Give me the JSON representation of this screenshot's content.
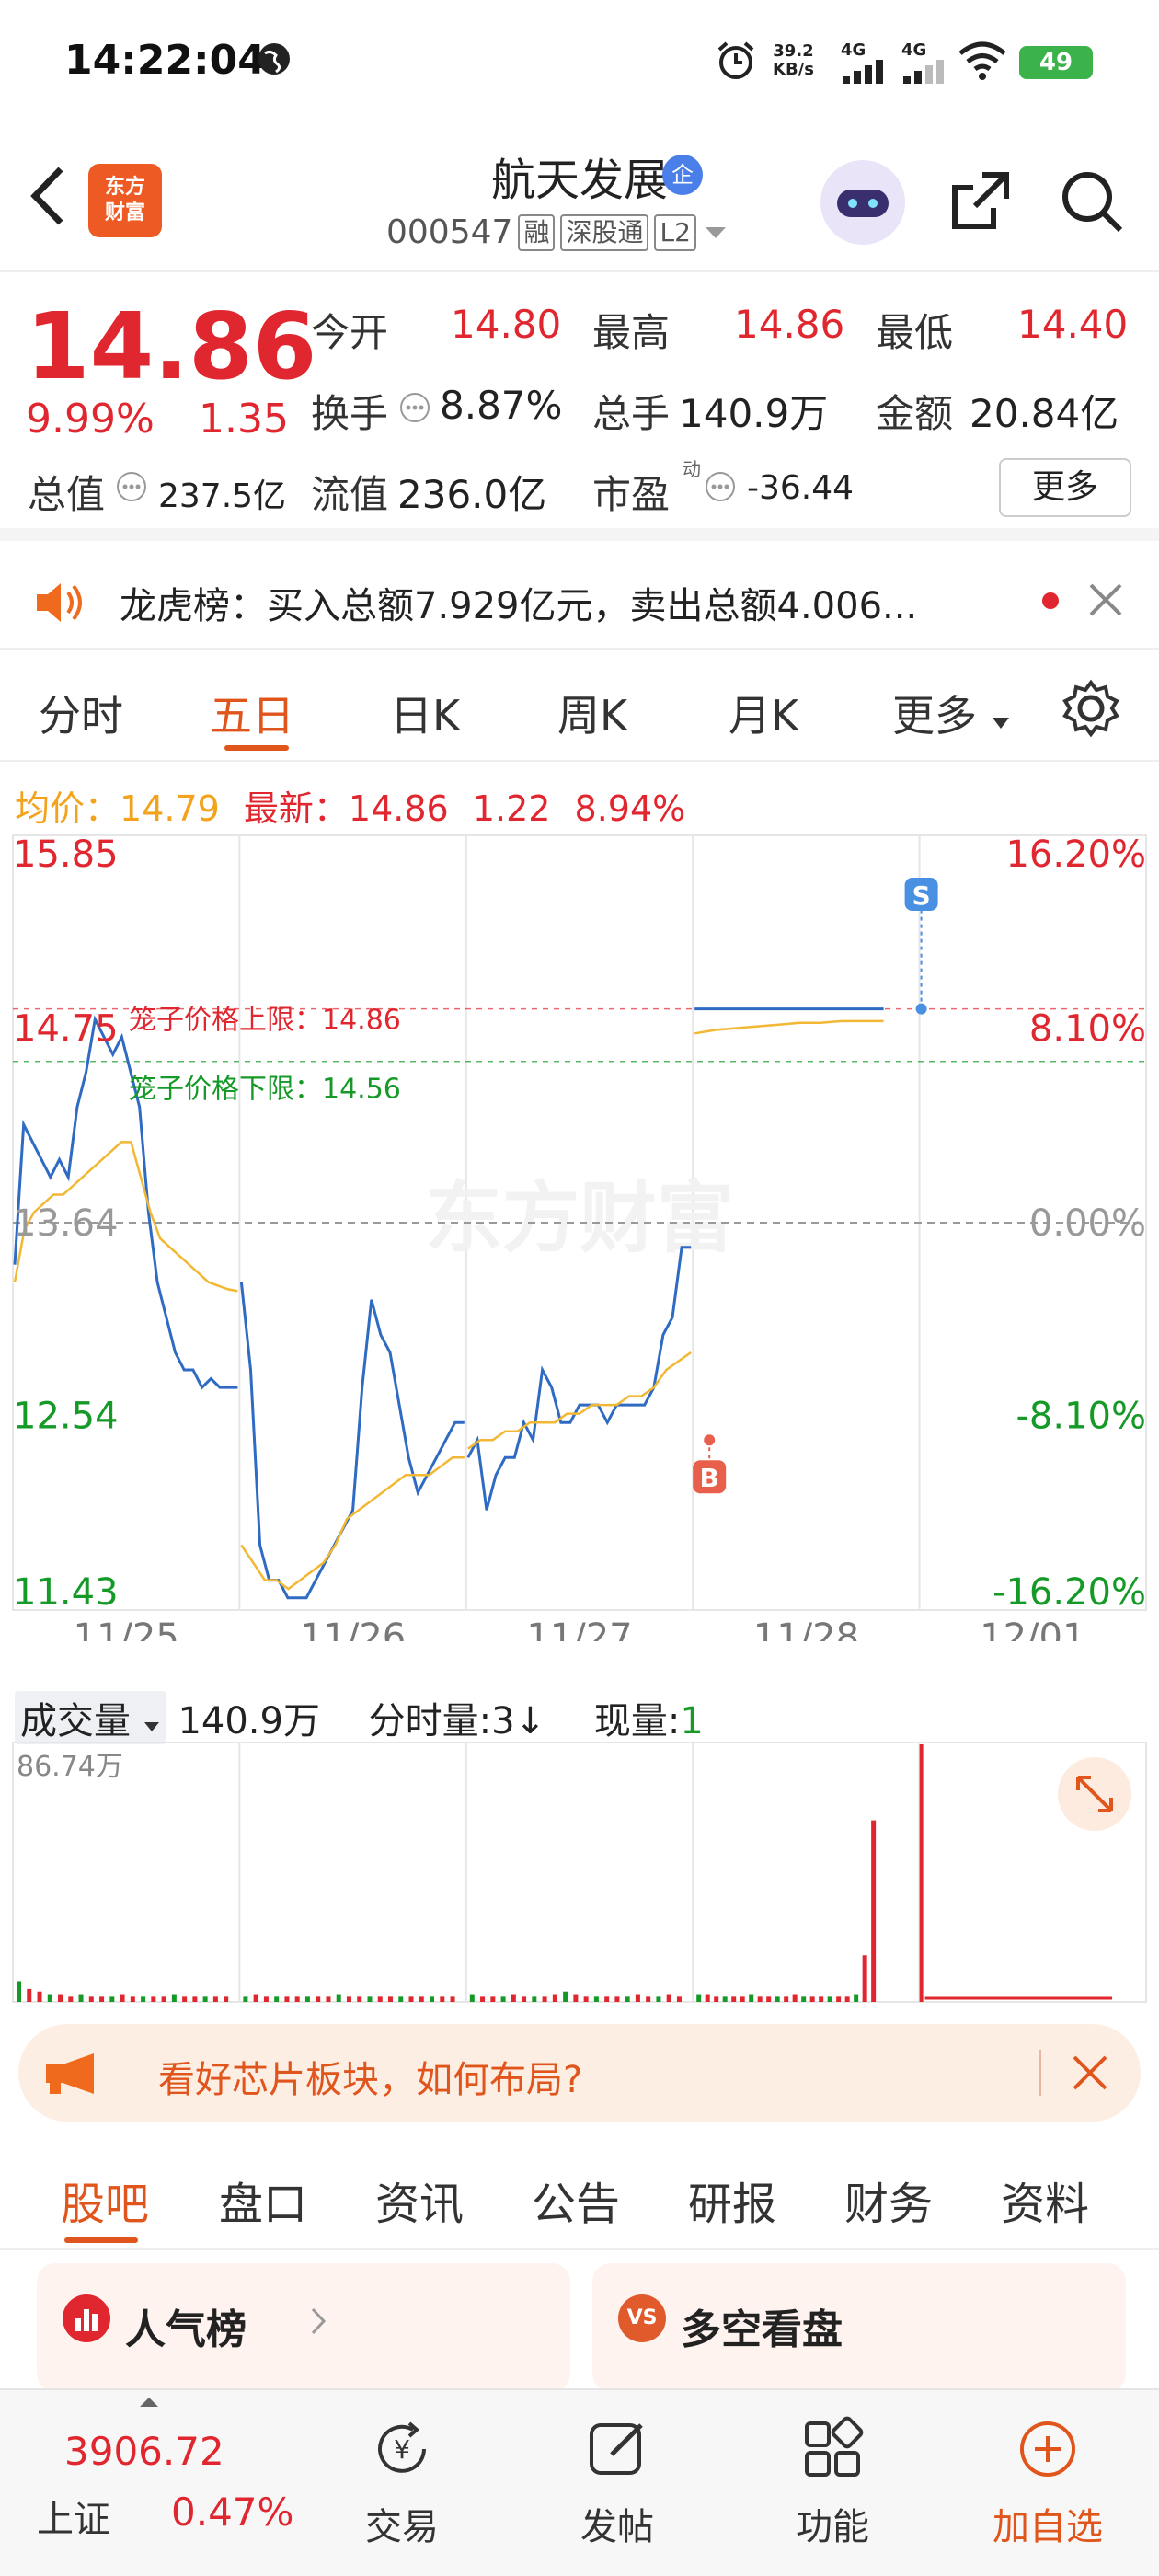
{
  "status_bar": {
    "time": "14:22:04",
    "net_speed": "39.2",
    "net_unit": "KB/s",
    "signal1": "4G",
    "signal2": "4G",
    "battery": "49"
  },
  "header": {
    "logo_text": "东方\n财富",
    "stock_name": "航天发展",
    "badge": "企",
    "stock_code": "000547",
    "tags": [
      "融",
      "深股通",
      "L2"
    ]
  },
  "quote": {
    "price": "14.86",
    "change_pct": "9.99%",
    "change": "1.35",
    "rows": [
      [
        {
          "label": "今开",
          "value": "14.80",
          "color": "red"
        },
        {
          "label": "最高",
          "value": "14.86",
          "color": "red"
        },
        {
          "label": "最低",
          "value": "14.40",
          "color": "red"
        }
      ],
      [
        {
          "label": "换手",
          "value": "8.87%",
          "color": "dark"
        },
        {
          "label": "总手",
          "value": "140.9万",
          "color": "dark"
        },
        {
          "label": "金额",
          "value": "20.84亿",
          "color": "dark"
        }
      ],
      [
        {
          "label": "总值",
          "value": "237.5亿",
          "color": "dark"
        },
        {
          "label": "流值",
          "value": "236.0亿",
          "color": "dark"
        },
        {
          "label": "市盈",
          "superscript": "动",
          "value": "-36.44",
          "color": "dark"
        }
      ]
    ],
    "more_label": "更多"
  },
  "notice": {
    "text": "龙虎榜：买入总额7.929亿元，卖出总额4.006..."
  },
  "chart_tabs": [
    "分时",
    "五日",
    "日K",
    "周K",
    "月K",
    "更多"
  ],
  "chart_tabs_active": 1,
  "avg_row": {
    "avg_label": "均价：",
    "avg_value": "14.79",
    "latest_label": "最新：",
    "latest_value": "14.86",
    "change": "1.22",
    "change_pct": "8.94%"
  },
  "chart_data": {
    "type": "line",
    "title": "",
    "x_ticks": [
      "11/25",
      "11/26",
      "11/27",
      "11/28",
      "12/01"
    ],
    "y_left_ticks": [
      "15.85",
      "14.75",
      "13.64",
      "12.54",
      "11.43"
    ],
    "y_right_ticks": [
      "16.20%",
      "8.10%",
      "0.00%",
      "-8.10%",
      "-16.20%"
    ],
    "ylim": [
      11.43,
      15.85
    ],
    "prev_close": 13.64,
    "limit_up_label": "笼子价格上限：14.86",
    "limit_down_label": "笼子价格下限：14.56",
    "limit_up": 14.86,
    "limit_down": 14.56,
    "watermark": "东方财富",
    "markers": [
      {
        "label": "S",
        "day": 4,
        "value": 14.86
      },
      {
        "label": "B",
        "day": 3,
        "value": 12.4
      }
    ],
    "series": [
      {
        "color": "#2f6bc2",
        "days": [
          [
            13.4,
            14.2,
            14.1,
            14.0,
            13.9,
            14.0,
            13.9,
            14.3,
            14.5,
            14.8,
            14.7,
            14.6,
            14.7,
            14.5,
            14.3,
            13.7,
            13.3,
            13.1,
            12.9,
            12.8,
            12.8,
            12.7,
            12.75,
            12.7,
            12.7,
            12.7
          ],
          [
            13.3,
            12.8,
            11.8,
            11.6,
            11.6,
            11.5,
            11.5,
            11.5,
            11.6,
            11.7,
            11.8,
            11.9,
            12.0,
            12.7,
            13.2,
            13.0,
            12.9,
            12.6,
            12.3,
            12.1,
            12.2,
            12.3,
            12.4,
            12.5,
            12.5
          ],
          [
            12.3,
            12.4,
            12.0,
            12.2,
            12.3,
            12.3,
            12.5,
            12.4,
            12.8,
            12.7,
            12.5,
            12.5,
            12.6,
            12.6,
            12.6,
            12.5,
            12.6,
            12.6,
            12.6,
            12.6,
            12.7,
            13.0,
            13.1,
            13.5,
            13.5
          ],
          [
            14.86,
            14.86,
            14.86,
            14.86,
            14.86,
            14.86,
            14.86,
            14.86,
            14.86,
            14.86
          ]
        ]
      },
      {
        "color": "#f2b733",
        "days": [
          [
            13.3,
            13.6,
            13.7,
            13.75,
            13.8,
            13.8,
            13.85,
            13.9,
            13.95,
            14.0,
            14.05,
            14.1,
            14.1,
            13.9,
            13.7,
            13.55,
            13.5,
            13.45,
            13.4,
            13.35,
            13.3,
            13.28,
            13.26,
            13.25
          ],
          [
            11.8,
            11.7,
            11.6,
            11.6,
            11.55,
            11.6,
            11.65,
            11.7,
            11.8,
            11.95,
            12.0,
            12.05,
            12.1,
            12.15,
            12.2,
            12.2,
            12.2,
            12.25,
            12.3,
            12.3
          ],
          [
            12.35,
            12.4,
            12.4,
            12.45,
            12.45,
            12.5,
            12.5,
            12.5,
            12.55,
            12.55,
            12.6,
            12.6,
            12.6,
            12.65,
            12.65,
            12.7,
            12.8,
            12.85,
            12.9
          ],
          [
            14.72,
            14.74,
            14.75,
            14.76,
            14.77,
            14.78,
            14.78,
            14.79,
            14.79,
            14.79
          ]
        ]
      }
    ]
  },
  "volume": {
    "label": "成交量",
    "total": "140.9万",
    "fs_label": "分时量:3",
    "fs_arrow": "↓",
    "cur_label": "现量:",
    "cur_value": "1",
    "max_label": "86.74万",
    "bars": [
      [
        8,
        5,
        4,
        3,
        3,
        2,
        3,
        2,
        2,
        2,
        3,
        2,
        2,
        2,
        2,
        3,
        2,
        2,
        2,
        2,
        2
      ],
      [
        2,
        3,
        2,
        2,
        2,
        2,
        2,
        2,
        2,
        3,
        2,
        2,
        2,
        2,
        2,
        2,
        2,
        2,
        2,
        2,
        2
      ],
      [
        3,
        2,
        2,
        2,
        3,
        2,
        2,
        2,
        3,
        4,
        3,
        2,
        2,
        2,
        2,
        2,
        3,
        2,
        2,
        3,
        2
      ],
      [
        3,
        3,
        2,
        2,
        2,
        2,
        3,
        2,
        2,
        2,
        2,
        3,
        2,
        2,
        2,
        2,
        2,
        2,
        3,
        18,
        70
      ]
    ]
  },
  "banner": {
    "text": "看好芯片板块，如何布局?"
  },
  "section_tabs": [
    "股吧",
    "盘口",
    "资讯",
    "公告",
    "研报",
    "财务",
    "资料"
  ],
  "section_tabs_active": 0,
  "cards": [
    {
      "title": "人气榜",
      "icon": "ranking-icon",
      "color": "#e0262e"
    },
    {
      "title": "多空看盘",
      "icon": "vs-icon",
      "color": "#e05a2c"
    }
  ],
  "bottom_nav": {
    "index_value": "3906.72",
    "index_name": "上证",
    "index_pct": "0.47%",
    "items": [
      {
        "label": "交易",
        "icon": "trade-icon"
      },
      {
        "label": "发帖",
        "icon": "post-icon"
      },
      {
        "label": "功能",
        "icon": "grid-icon"
      },
      {
        "label": "加自选",
        "icon": "add-circle-icon",
        "accent": "#e0551c"
      }
    ]
  }
}
